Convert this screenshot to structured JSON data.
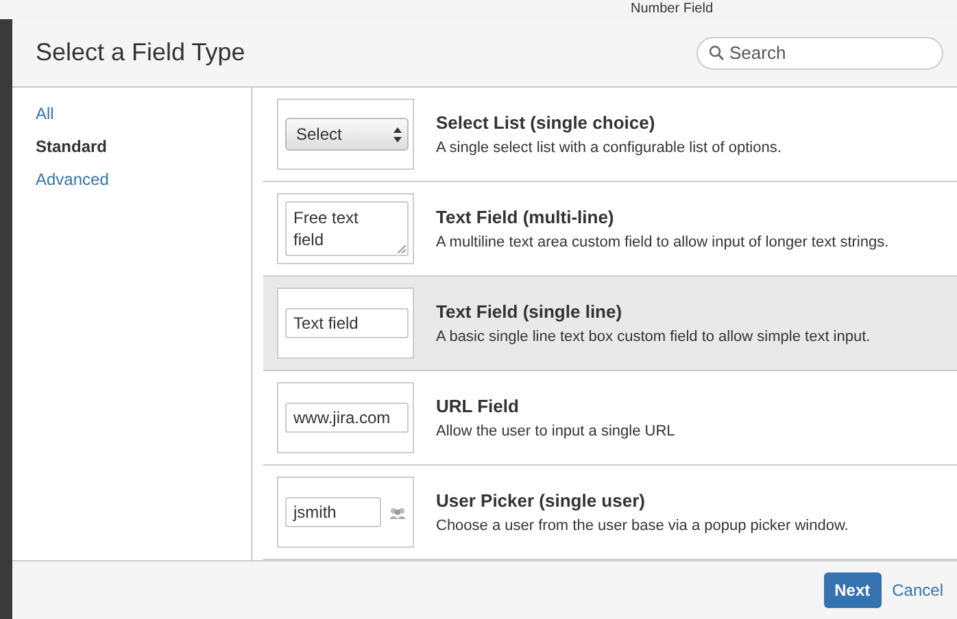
{
  "background": {
    "text": "Number Field"
  },
  "dialog": {
    "title": "Select a Field Type",
    "search": {
      "placeholder": "Search"
    }
  },
  "sidebar": {
    "items": [
      {
        "label": "All",
        "selected": false
      },
      {
        "label": "Standard",
        "selected": true
      },
      {
        "label": "Advanced",
        "selected": false
      }
    ]
  },
  "field_types": [
    {
      "kind": "select",
      "preview": "Select",
      "name": "Select List (single choice)",
      "description": "A single select list with a configurable list of options.",
      "selected": false
    },
    {
      "kind": "textarea",
      "preview": "Free text field",
      "name": "Text Field (multi-line)",
      "description": "A multiline text area custom field to allow input of longer text strings.",
      "selected": false
    },
    {
      "kind": "text",
      "preview": "Text field",
      "name": "Text Field (single line)",
      "description": "A basic single line text box custom field to allow simple text input.",
      "selected": true
    },
    {
      "kind": "text",
      "preview": "www.jira.com",
      "name": "URL Field",
      "description": "Allow the user to input a single URL",
      "selected": false
    },
    {
      "kind": "user",
      "preview": "jsmith",
      "name": "User Picker (single user)",
      "description": "Choose a user from the user base via a popup picker window.",
      "selected": false
    }
  ],
  "buttons": {
    "next": "Next",
    "cancel": "Cancel"
  }
}
